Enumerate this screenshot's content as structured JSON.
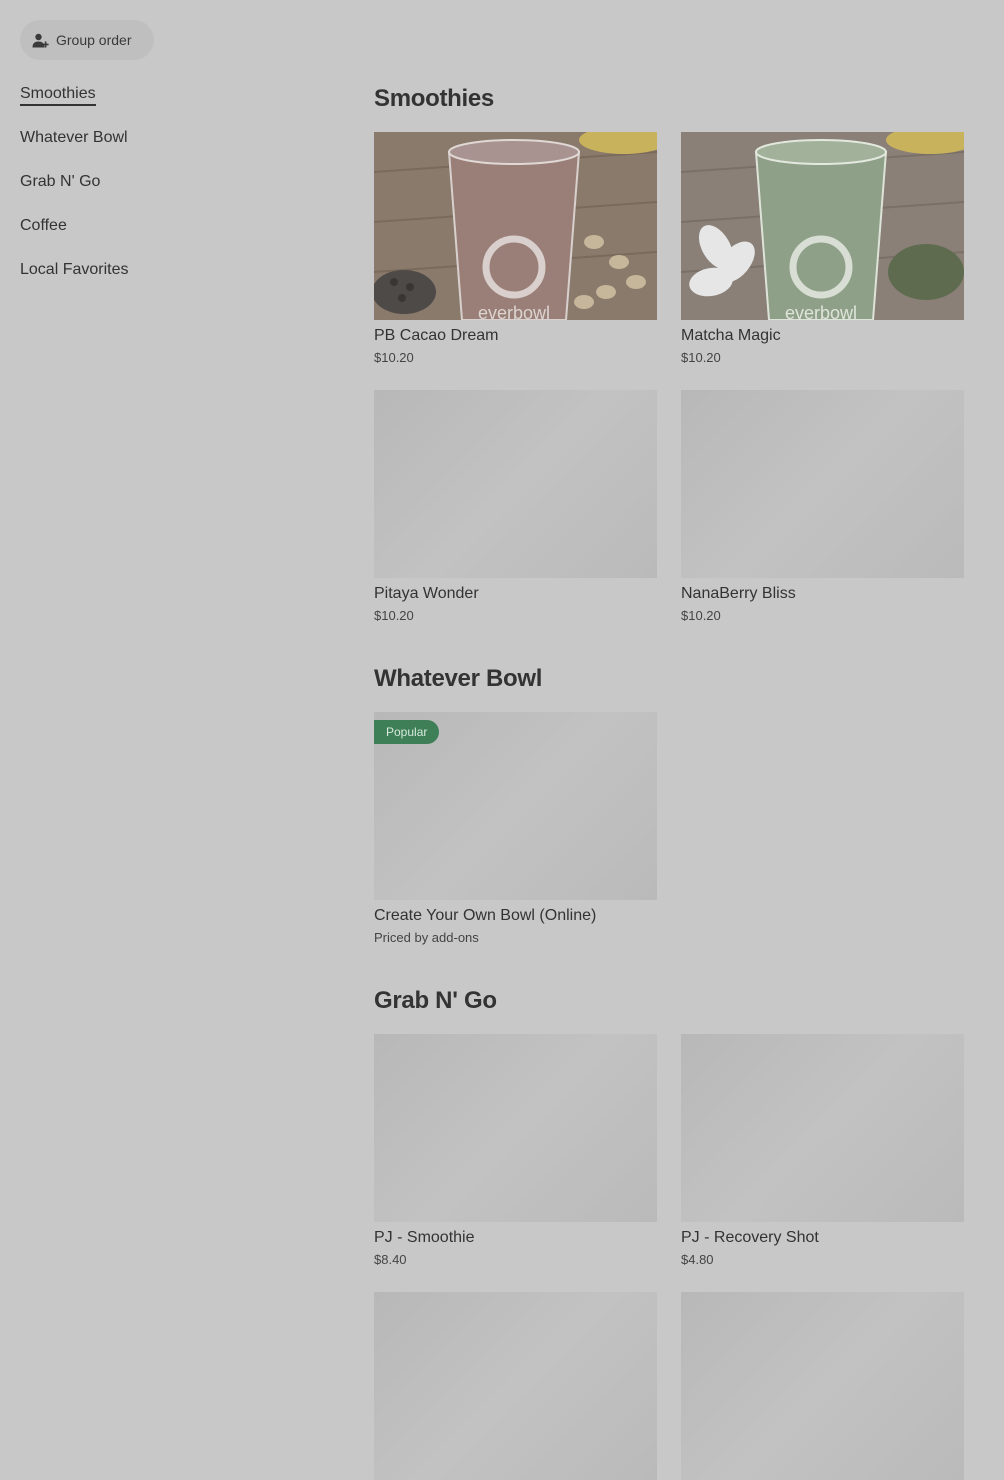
{
  "header": {
    "group_order_label": "Group order",
    "group_order_icon": "add-person-icon"
  },
  "sidebar": {
    "items": [
      {
        "label": "Smoothies",
        "active": true
      },
      {
        "label": "Whatever Bowl",
        "active": false
      },
      {
        "label": "Grab N' Go",
        "active": false
      },
      {
        "label": "Coffee",
        "active": false
      },
      {
        "label": "Local Favorites",
        "active": false
      }
    ]
  },
  "sections": [
    {
      "title": "Smoothies",
      "items": [
        {
          "name": "PB Cacao Dream",
          "price": "$10.20"
        },
        {
          "name": "Matcha Magic",
          "price": "$10.20"
        },
        {
          "name": "Pitaya Wonder",
          "price": "$10.20"
        },
        {
          "name": "NanaBerry Bliss",
          "price": "$10.20"
        }
      ]
    },
    {
      "title": "Whatever Bowl",
      "items": [
        {
          "name": "Create Your Own Bowl (Online)",
          "price": "Priced by add-ons",
          "badge": "Popular"
        }
      ]
    },
    {
      "title": "Grab N' Go",
      "items": [
        {
          "name": "PJ - Smoothie",
          "price": "$8.40"
        },
        {
          "name": "PJ - Recovery Shot",
          "price": "$4.80"
        }
      ]
    }
  ],
  "brand_text": "everbowl",
  "colors": {
    "overlay_bg": "#c8c8c8",
    "badge_bg": "#3f7f57"
  }
}
